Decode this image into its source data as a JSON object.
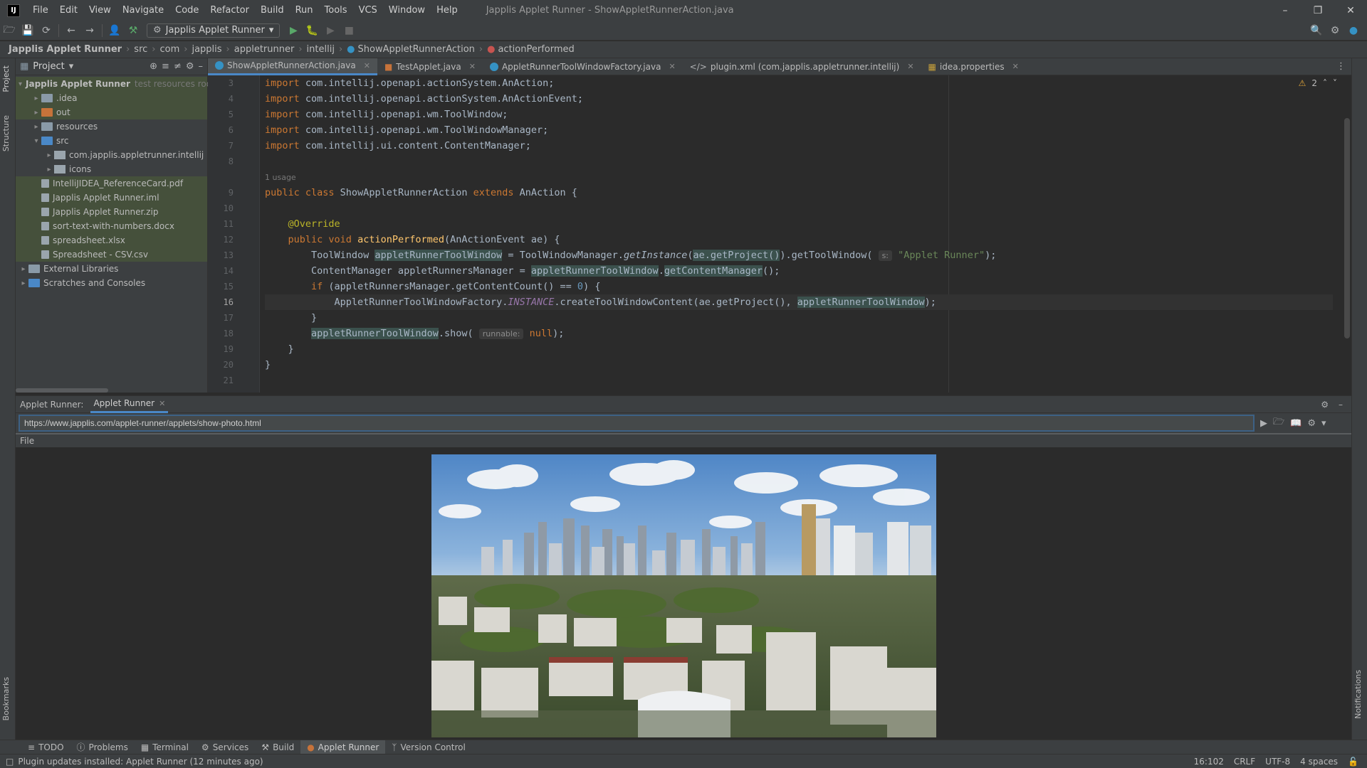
{
  "window": {
    "title": "Japplis Applet Runner - ShowAppletRunnerAction.java",
    "menu": [
      "File",
      "Edit",
      "View",
      "Navigate",
      "Code",
      "Refactor",
      "Build",
      "Run",
      "Tools",
      "VCS",
      "Window",
      "Help"
    ]
  },
  "toolbar": {
    "run_config": "Japplis Applet Runner"
  },
  "breadcrumb": [
    "Japplis Applet Runner",
    "src",
    "com",
    "japplis",
    "appletrunner",
    "intellij",
    "ShowAppletRunnerAction",
    "actionPerformed"
  ],
  "project": {
    "title": "Project",
    "root_label": "Japplis Applet Runner",
    "root_hint": "test resources root,",
    "items": [
      ".idea",
      "out",
      "resources",
      "src",
      "com.japplis.appletrunner.intellij",
      "icons",
      "IntelliJIDEA_ReferenceCard.pdf",
      "Japplis Applet Runner.iml",
      "Japplis Applet Runner.zip",
      "sort-text-with-numbers.docx",
      "spreadsheet.xlsx",
      "Spreadsheet - CSV.csv",
      "External Libraries",
      "Scratches and Consoles"
    ]
  },
  "tabs": [
    "ShowAppletRunnerAction.java",
    "TestApplet.java",
    "AppletRunnerToolWindowFactory.java",
    "plugin.xml (com.japplis.appletrunner.intellij)",
    "idea.properties"
  ],
  "editor": {
    "line_numbers": [
      "3",
      "4",
      "5",
      "6",
      "7",
      "8",
      "",
      "9",
      "10",
      "11",
      "12",
      "13",
      "14",
      "15",
      "16",
      "17",
      "18",
      "19",
      "20",
      "21"
    ],
    "warnings": "2",
    "usage_hint": "1 usage",
    "param_hint_s": "s:",
    "param_hint_runnable": "runnable:",
    "string_applet_runner": "\"Applet Runner\""
  },
  "toolwindow": {
    "title": "Applet Runner:",
    "tab": "Applet Runner",
    "url": "https://www.japplis.com/applet-runner/applets/show-photo.html",
    "file_menu": "File"
  },
  "bottom_tabs": [
    "TODO",
    "Problems",
    "Terminal",
    "Services",
    "Build",
    "Applet Runner",
    "Version Control"
  ],
  "status": {
    "message": "Plugin updates installed: Applet Runner (12 minutes ago)",
    "position": "16:102",
    "line_sep": "CRLF",
    "encoding": "UTF-8",
    "indent": "4 spaces"
  },
  "side_tabs": {
    "project": "Project",
    "structure": "Structure",
    "bookmarks": "Bookmarks",
    "notifications": "Notifications"
  }
}
